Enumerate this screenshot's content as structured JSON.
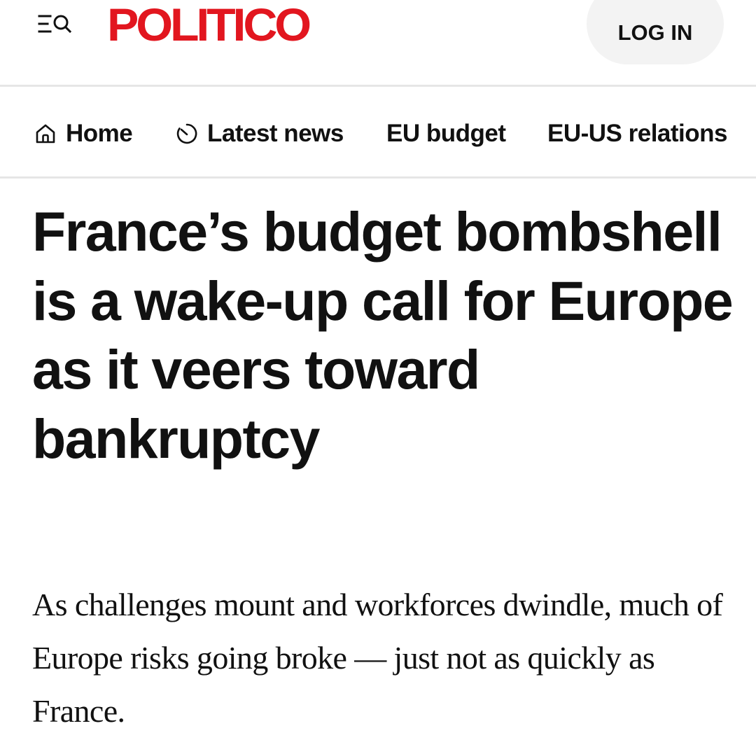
{
  "header": {
    "menu_icon": "menu-search-icon",
    "logo": "POLITICO",
    "login_label": "LOG IN",
    "brand_color": "#e2161f"
  },
  "nav": {
    "items": [
      {
        "label": "Home",
        "icon": "home-icon"
      },
      {
        "label": "Latest news",
        "icon": "clock-icon"
      },
      {
        "label": "EU budget"
      },
      {
        "label": "EU-US relations"
      }
    ]
  },
  "article": {
    "headline": "France’s budget bombshell is a wake-up call for Europe as it veers toward bankruptcy",
    "dek": "As challenges mount and workforces dwindle, much of Europe risks going broke — just not as quickly as France."
  }
}
